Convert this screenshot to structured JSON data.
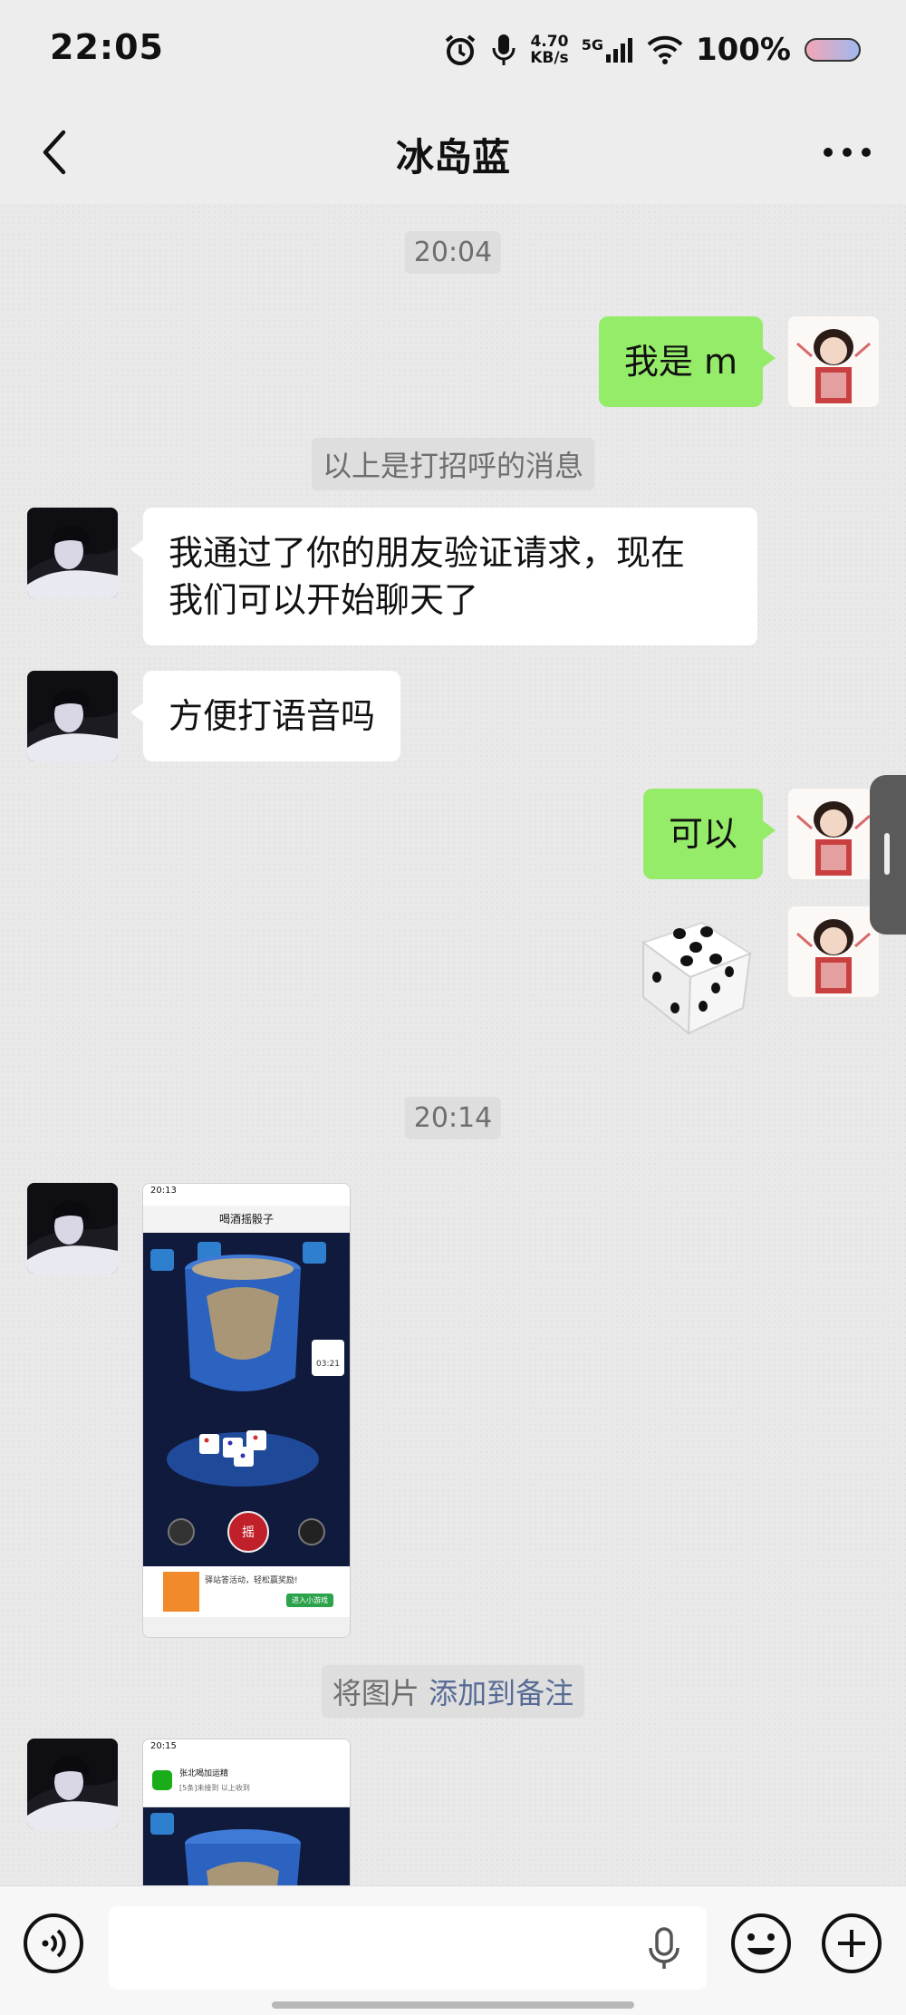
{
  "status_bar": {
    "time": "22:05",
    "speed_value": "4.70",
    "speed_unit": "KB/s",
    "network": "5G",
    "battery": "100%"
  },
  "header": {
    "title": "冰岛蓝"
  },
  "messages": {
    "ts1": "20:04",
    "m1": "我是 m",
    "sys1": "以上是打招呼的消息",
    "m2_line1": "我通过了你的朋友验证请求，现在",
    "m2_line2": "我们可以开始聊天了",
    "m3": "方便打语音吗",
    "m4": "可以",
    "dice_face": 5,
    "ts2": "20:14",
    "sys2_prefix": "将图片",
    "sys2_link": "添加到备注"
  },
  "shot1": {
    "time": "20:13",
    "title": "喝酒摇骰子",
    "call_time": "03:21",
    "shake_label": "摇",
    "ad_text": "驿站答活动，轻松赢奖励!",
    "ad_button": "进入小游戏"
  },
  "shot2": {
    "time": "20:15",
    "notif_title": "张北喝加运精",
    "notif_sub": "[5条]未接到 以上收到"
  },
  "input": {
    "placeholder": ""
  }
}
